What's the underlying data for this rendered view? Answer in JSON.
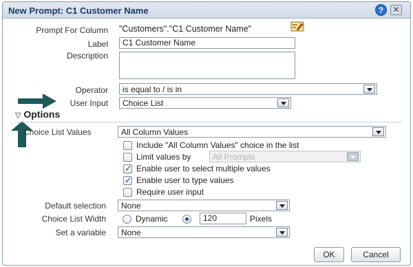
{
  "dialog": {
    "title": "New Prompt: C1 Customer Name"
  },
  "form": {
    "prompt_for_column_label": "Prompt For Column",
    "prompt_for_column_value": "\"Customers\".\"C1 Customer Name\"",
    "label_label": "Label",
    "label_value": "C1  Customer Name",
    "description_label": "Description",
    "description_value": "",
    "operator_label": "Operator",
    "operator_value": "is equal to / is in",
    "user_input_label": "User Input",
    "user_input_value": "Choice List"
  },
  "options": {
    "header": "Options",
    "choice_list_values_label": "Choice List Values",
    "choice_list_values_value": "All Column Values",
    "checkboxes": [
      {
        "label": "Include \"All Column Values\" choice in the list",
        "checked": false
      },
      {
        "label": "Limit values by",
        "checked": false
      },
      {
        "label": "Enable user to select multiple values",
        "checked": true
      },
      {
        "label": "Enable user to type values",
        "checked": true
      },
      {
        "label": "Require user input",
        "checked": false
      }
    ],
    "limit_values_by_value": "All Prompts",
    "default_selection_label": "Default selection",
    "default_selection_value": "None",
    "choice_list_width_label": "Choice List Width",
    "dynamic_label": "Dynamic",
    "width_value": "120",
    "pixels_label": "Pixels",
    "set_variable_label": "Set a variable",
    "set_variable_value": "None"
  },
  "buttons": {
    "ok": "OK",
    "cancel": "Cancel"
  },
  "icons": {
    "help": "help-icon",
    "close": "close-icon",
    "edit": "edit-column-icon",
    "collapse": "triangle-down-icon",
    "annotation_arrow_right": "arrow-right-icon",
    "annotation_arrow_up": "arrow-up-icon"
  },
  "colors": {
    "title_text": "#1d3a66",
    "annotation_arrow": "#1f5a5a"
  }
}
